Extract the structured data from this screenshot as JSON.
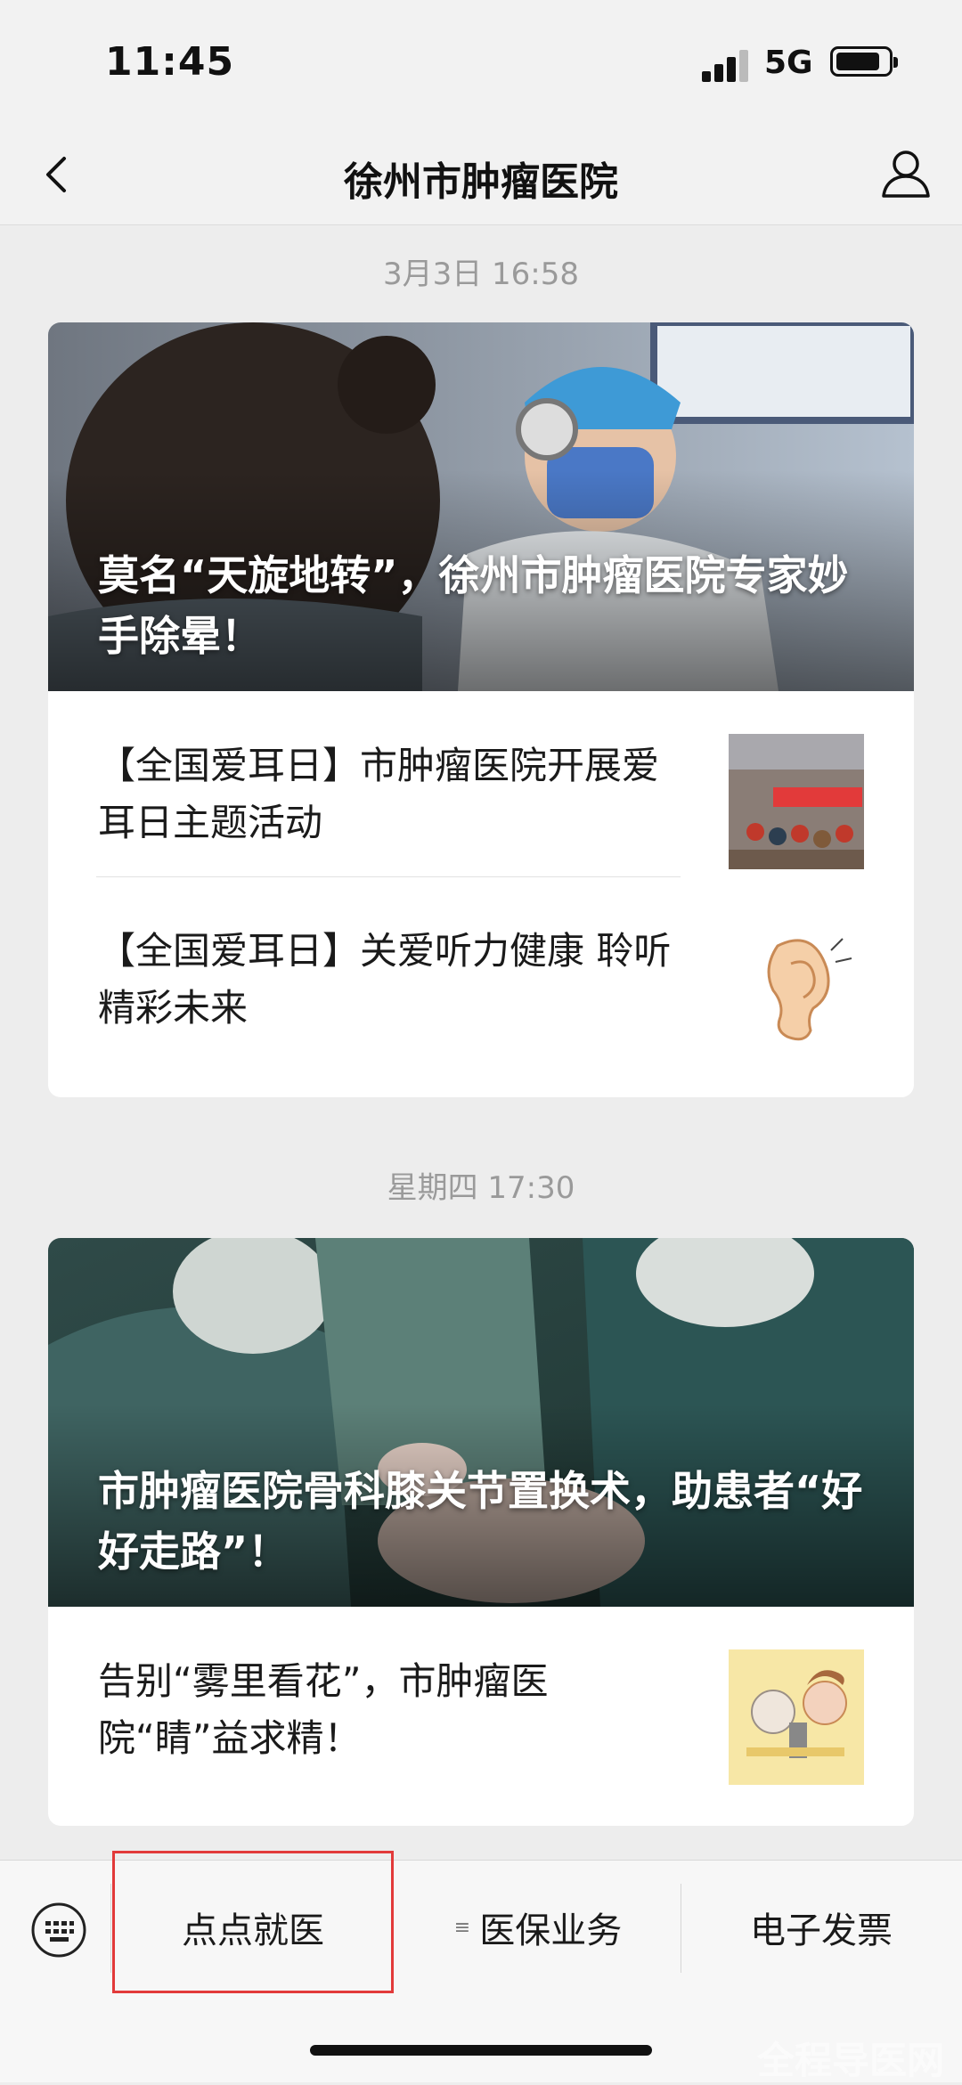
{
  "status_bar": {
    "time": "11:45",
    "network": "5G"
  },
  "nav": {
    "title": "徐州市肿瘤医院"
  },
  "messages": [
    {
      "timestamp": "3月3日 16:58",
      "headline": "莫名“天旋地转”，徐州市肿瘤医院专家妙手除晕！",
      "items": [
        {
          "title": "【全国爱耳日】市肿瘤医院开展爱耳日主题活动"
        },
        {
          "title": "【全国爱耳日】关爱听力健康 聆听精彩未来"
        }
      ]
    },
    {
      "timestamp": "星期四 17:30",
      "headline": "市肿瘤医院骨科膝关节置换术，助患者“好好走路”！",
      "items": [
        {
          "title": "告别“雾里看花”，市肿瘤医院“睛”益求精！"
        }
      ]
    }
  ],
  "menu": {
    "items": [
      {
        "label": "点点就医"
      },
      {
        "label": "医保业务",
        "prefix": "≡"
      },
      {
        "label": "电子发票"
      }
    ]
  },
  "watermark": "全程导医网",
  "colors": {
    "highlight": "#e23a3a",
    "background": "#ededed"
  }
}
